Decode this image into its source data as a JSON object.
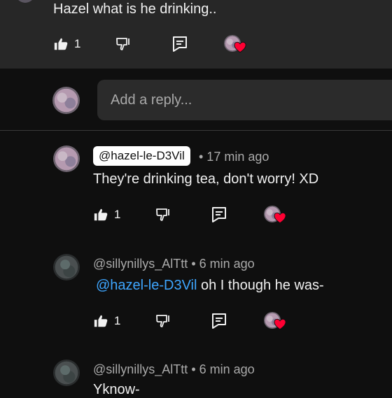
{
  "top_comment": {
    "text": "Hazel what is he drinking..",
    "like_count": "1"
  },
  "reply_input": {
    "placeholder": "Add a reply..."
  },
  "replies": [
    {
      "handle": "@hazel-le-D3Vil",
      "time": "• 17 min ago",
      "text": "They're drinking tea, don't worry! XD",
      "like_count": "1"
    },
    {
      "handle": "@sillynillys_AlTtt",
      "time": "• 6 min ago",
      "mention": "@hazel-le-D3Vil",
      "text": " oh I though he was-",
      "like_count": "1"
    },
    {
      "handle": "@sillynillys_AlTtt",
      "time": "• 6 min ago",
      "text": "Yknow-"
    }
  ],
  "icons": {
    "like": "thumbs-up-icon",
    "dislike": "thumbs-down-icon",
    "reply": "reply-icon",
    "creator_heart": "creator-heart-icon"
  },
  "colors": {
    "background": "#0f0f0f",
    "highlight": "#272727",
    "mention": "#3ea6ff",
    "heart": "#ff0033"
  }
}
